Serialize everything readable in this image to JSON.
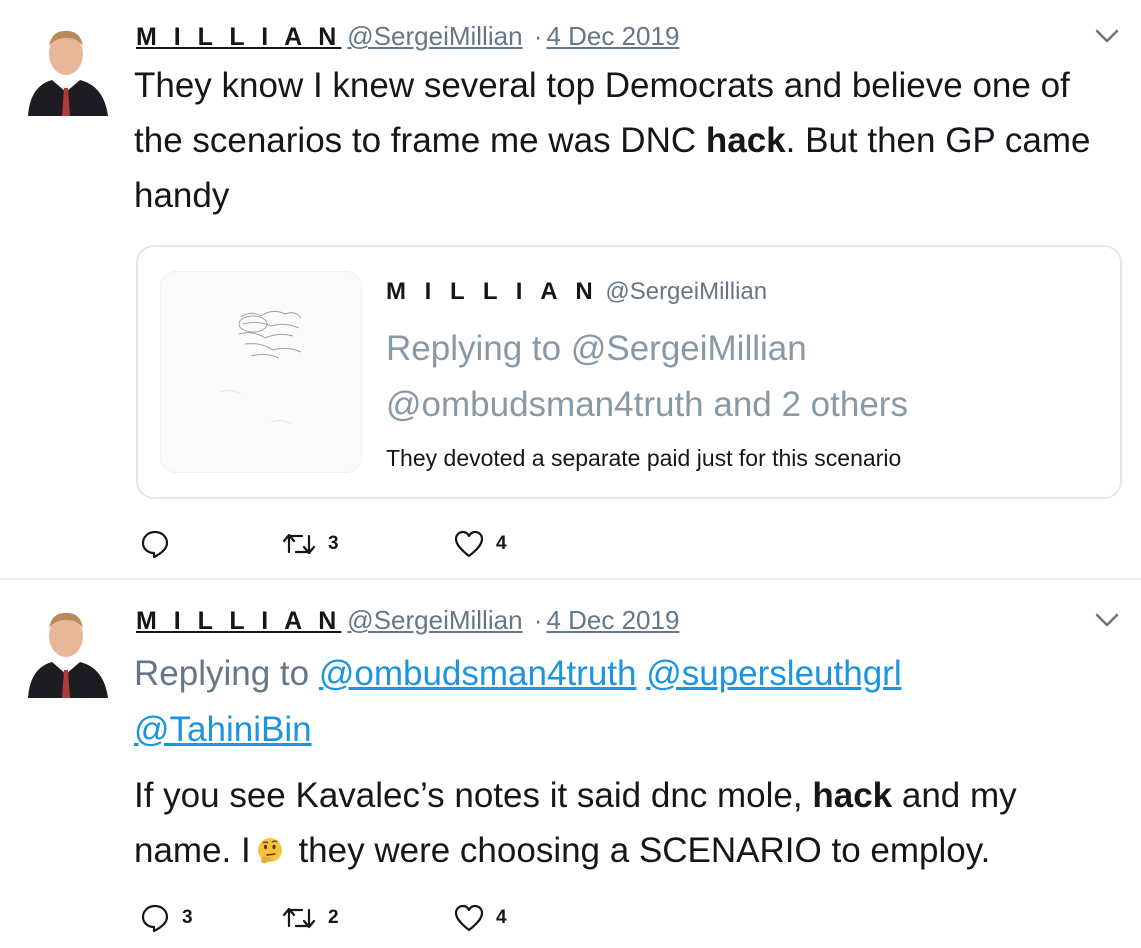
{
  "colors": {
    "link": "#1b95e0",
    "muted": "#657786",
    "border": "#e1e8ed",
    "text": "#14171a"
  },
  "tweets": [
    {
      "author_name": "M I L L I A N",
      "handle": "@SergeiMillian",
      "separator": "·",
      "date": "4 Dec 2019",
      "text_before": "They know I knew several top Democrats and believe one of the scenarios to frame me was DNC ",
      "text_bold": "hack",
      "text_after": ". But then GP came handy",
      "quote": {
        "author_name": "M I L L I A N",
        "handle": "@SergeiMillian",
        "reply_text": "Replying to @SergeiMillian @ombudsman4truth and 2 others",
        "text": "They devoted a separate paid just for this scenario"
      },
      "actions": {
        "reply_count": "",
        "retweet_count": "3",
        "like_count": "4"
      }
    },
    {
      "author_name": "M I L L I A N",
      "handle": "@SergeiMillian",
      "separator": "·",
      "date": "4 Dec 2019",
      "replying_prefix": "Replying to",
      "replying_to": [
        "@ombudsman4truth",
        "@supersleuthgrl",
        "@TahiniBin"
      ],
      "text_before": "If you see Kavalec’s notes it said dnc mole, ",
      "text_bold": "hack",
      "text_mid": " and my name. I",
      "emoji": "thinking-face-emoji",
      "text_after": " they were choosing a SCENARIO to employ.",
      "actions": {
        "reply_count": "3",
        "retweet_count": "2",
        "like_count": "4"
      }
    }
  ],
  "icons": [
    "avatar",
    "chevron-down-icon",
    "reply-icon",
    "retweet-icon",
    "heart-icon"
  ]
}
